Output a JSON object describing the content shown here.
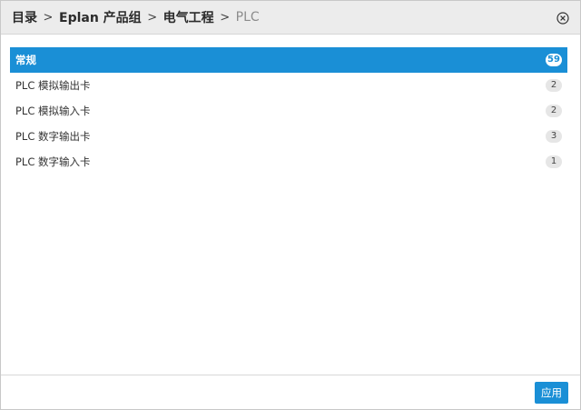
{
  "breadcrumb": {
    "items": [
      "目录",
      "Eplan 产品组",
      "电气工程",
      "PLC"
    ],
    "separator": ">"
  },
  "close_icon": "close-circle-icon",
  "list": {
    "items": [
      {
        "label": "常规",
        "count": "59",
        "selected": true
      },
      {
        "label": "PLC 模拟输出卡",
        "count": "2",
        "selected": false
      },
      {
        "label": "PLC 模拟输入卡",
        "count": "2",
        "selected": false
      },
      {
        "label": "PLC 数字输出卡",
        "count": "3",
        "selected": false
      },
      {
        "label": "PLC 数字输入卡",
        "count": "1",
        "selected": false
      }
    ]
  },
  "footer": {
    "apply_label": "应用"
  },
  "colors": {
    "accent": "#1a8fd6",
    "header_bg": "#ececec"
  }
}
